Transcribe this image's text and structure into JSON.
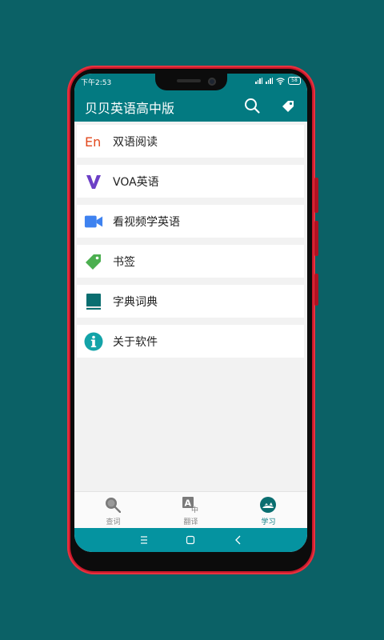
{
  "status": {
    "time": "下午2:53",
    "battery": "58"
  },
  "appbar": {
    "title": "贝贝英语高中版",
    "search_icon": "search-icon",
    "tag_icon": "tag-icon"
  },
  "menu": {
    "items": [
      {
        "label": "双语阅读",
        "icon": "en-text-icon",
        "color": "#e2491e"
      },
      {
        "label": "VOA英语",
        "icon": "v-logo-icon",
        "color": "#6c3fc6"
      },
      {
        "label": "看视频学英语",
        "icon": "video-camera-icon",
        "color": "#3e82f0"
      },
      {
        "label": "书签",
        "icon": "bookmark-tag-icon",
        "color": "#4caf50"
      },
      {
        "label": "字典词典",
        "icon": "book-icon",
        "color": "#0a6e70"
      },
      {
        "label": "关于软件",
        "icon": "info-icon",
        "color": "#13a3a8"
      }
    ]
  },
  "tabs": [
    {
      "label": "查词",
      "icon": "magnifier-icon"
    },
    {
      "label": "翻译",
      "icon": "translate-icon"
    },
    {
      "label": "学习",
      "icon": "learn-icon",
      "active": true
    }
  ],
  "theme": {
    "primary": "#037a81",
    "background": "#0b6166",
    "phone_frame": "#c9182a"
  }
}
